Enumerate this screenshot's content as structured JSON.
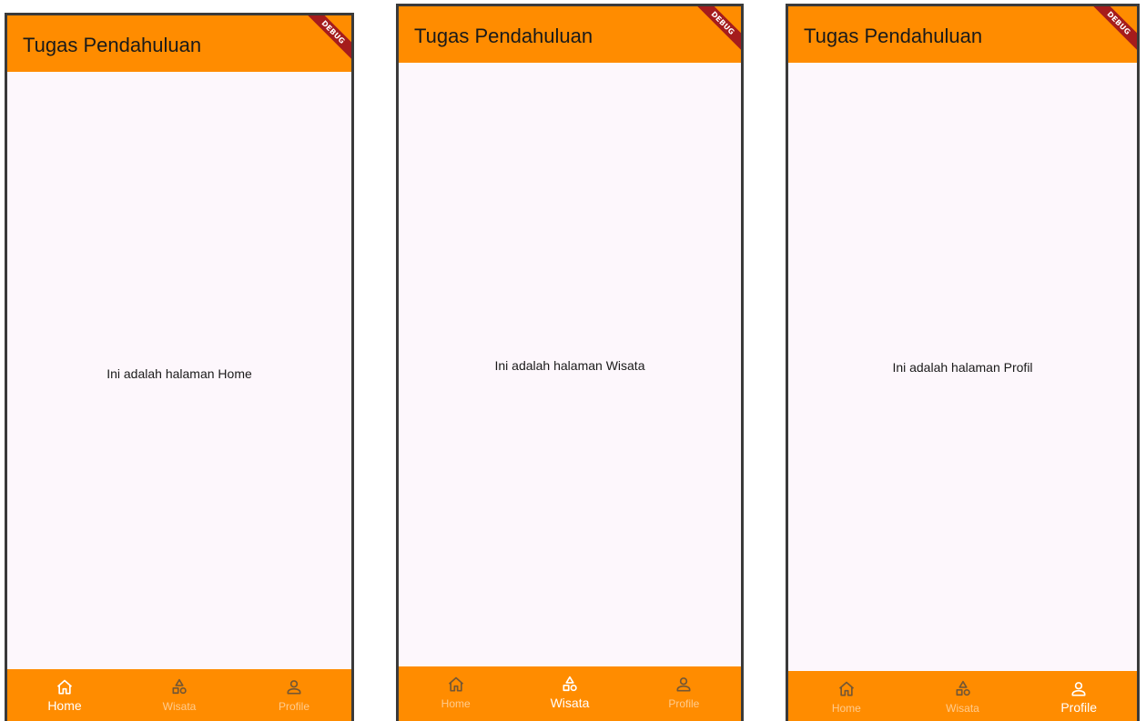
{
  "app": {
    "title": "Tugas Pendahuluan",
    "debug_label": "DEBUG",
    "colors": {
      "appbar": "#ff8c00",
      "background": "#fdf7fc",
      "debug_ribbon": "#a51c1c",
      "active_label": "#ffffff"
    }
  },
  "nav_items": [
    {
      "label": "Home",
      "icon": "home-icon"
    },
    {
      "label": "Wisata",
      "icon": "shapes-icon"
    },
    {
      "label": "Profile",
      "icon": "person-icon"
    }
  ],
  "screens": [
    {
      "title": "Tugas Pendahuluan",
      "body_text": "Ini adalah halaman Home",
      "active_tab": "Home",
      "nav": {
        "home": "Home",
        "wisata": "Wisata",
        "profile": "Profile"
      }
    },
    {
      "title": "Tugas Pendahuluan",
      "body_text": "Ini adalah halaman Wisata",
      "active_tab": "Wisata",
      "nav": {
        "home": "Home",
        "wisata": "Wisata",
        "profile": "Profile"
      }
    },
    {
      "title": "Tugas Pendahuluan",
      "body_text": "Ini adalah halaman Profil",
      "active_tab": "Profile",
      "nav": {
        "home": "Home",
        "wisata": "Wisata",
        "profile": "Profile"
      }
    }
  ]
}
